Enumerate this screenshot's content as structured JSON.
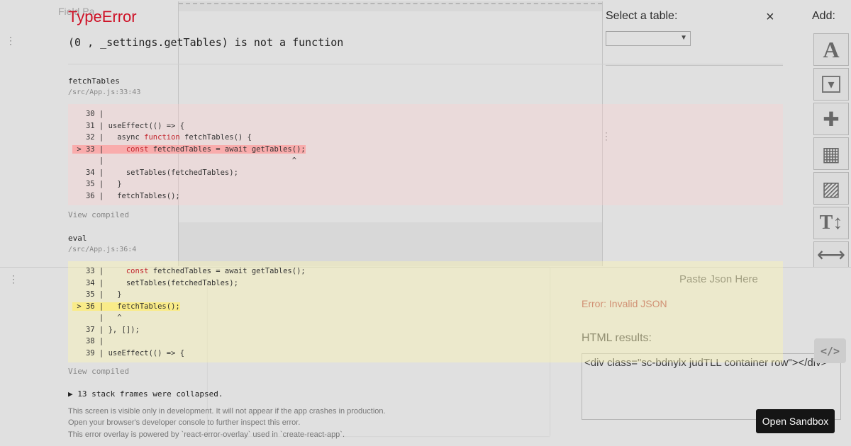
{
  "background": {
    "field_placeholder": "Field Pa...",
    "drag_handle": "⋮",
    "select_table_label": "Select a table:",
    "select_table_value": "",
    "add_label": "Add:",
    "tools": [
      {
        "icon": "text-icon",
        "glyph": "A"
      },
      {
        "icon": "dropdown-icon",
        "glyph": "▾"
      },
      {
        "icon": "plus-icon",
        "glyph": "✚"
      },
      {
        "icon": "calendar-icon",
        "glyph": "▦"
      },
      {
        "icon": "image-icon",
        "glyph": "▨"
      },
      {
        "icon": "text-height-icon",
        "glyph": "T↕"
      },
      {
        "icon": "horizontal-arrows-icon",
        "glyph": "⟷"
      }
    ],
    "paste_json_label": "Paste Json Here",
    "error_message": "Error: Invalid JSON",
    "html_results_label": "HTML results:",
    "html_result_value": "<div class=\"sc-bdnylx judTLL container row\"></div>",
    "code_button_label": "</>"
  },
  "overlay": {
    "title": "TypeError",
    "close_label": "×",
    "message": "(0 , _settings.getTables) is not a function",
    "frames": [
      {
        "function": "fetchTables",
        "location": "/src/App.js:33:43",
        "view_compiled": "View compiled",
        "lines": [
          "   30 |",
          "   31 | useEffect(() => {",
          "   32 |   async function fetchTables() {",
          " > 33 |     const fetchedTables = await getTables();",
          "      |                                          ^",
          "   34 |     setTables(fetchedTables);",
          "   35 |   }",
          "   36 |   fetchTables();"
        ]
      },
      {
        "function": "eval",
        "location": "/src/App.js:36:4",
        "view_compiled": "View compiled",
        "lines": [
          "   33 |     const fetchedTables = await getTables();",
          "   34 |     setTables(fetchedTables);",
          "   35 |   }",
          " > 36 |   fetchTables();",
          "      |   ^",
          "   37 | }, []);",
          "   38 |",
          "   39 | useEffect(() => {"
        ]
      }
    ],
    "collapsed_frames": "▶ 13 stack frames were collapsed.",
    "footer": [
      "This screen is visible only in development. It will not appear if the app crashes in production.",
      "Open your browser's developer console to further inspect this error.",
      "This error overlay is powered by `react-error-overlay` used in `create-react-app`."
    ]
  },
  "sandbox": {
    "open_label": "Open Sandbox"
  },
  "colors": {
    "error_red": "#ce1126",
    "highlight_red": "#fcd0d0",
    "highlight_yellow": "#fbf5b4",
    "sandbox_button": "#151515"
  }
}
